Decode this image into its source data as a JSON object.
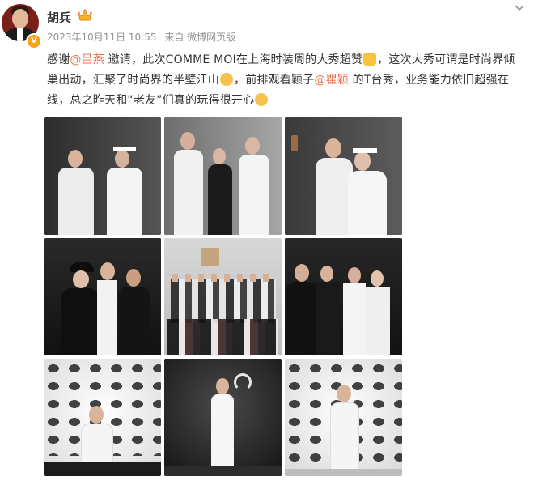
{
  "user": {
    "name": "胡兵",
    "verified_badge": "V"
  },
  "meta": {
    "timestamp": "2023年10月11日 10:55",
    "source": "来自 微博网页版"
  },
  "content": {
    "t1": "感谢",
    "mention1": "@吕燕",
    "t2": " 邀请，此次COMME MOI在上海时装周的大秀超赞",
    "t3": "，这次大秀可谓是时尚界倾巢出动，汇聚了时尚界的半壁江山",
    "t4": "，前排观看颖子",
    "mention2": "@瞿颖",
    "t5": " 的T台秀，业务能力依旧超强在线，总之昨天和“老友”们真的玩得很开心"
  },
  "photos": [
    {
      "id": 1
    },
    {
      "id": 2
    },
    {
      "id": 3
    },
    {
      "id": 4
    },
    {
      "id": 5
    },
    {
      "id": 6
    },
    {
      "id": 7
    },
    {
      "id": 8
    },
    {
      "id": 9
    }
  ],
  "colors": {
    "mention": "#eb7350",
    "meta": "#939393",
    "badge": "#f7a21b"
  }
}
